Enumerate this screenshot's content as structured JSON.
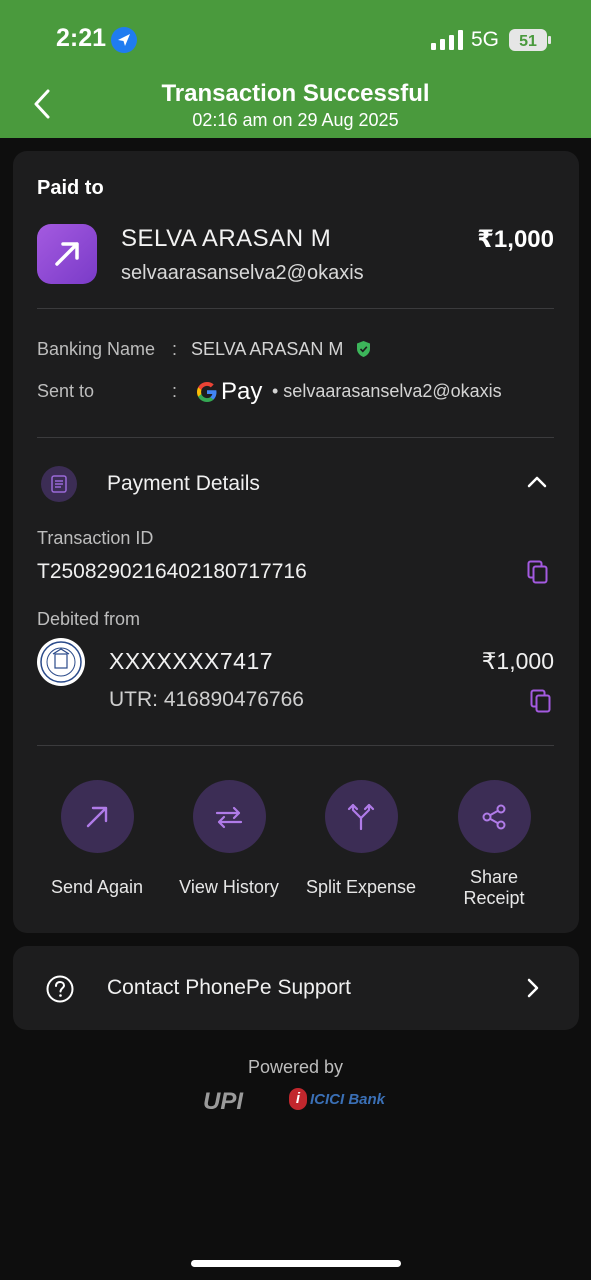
{
  "status_bar": {
    "time": "2:21",
    "network": "5G",
    "battery": "51"
  },
  "header": {
    "title": "Transaction Successful",
    "subtitle": "02:16 am on 29 Aug 2025"
  },
  "payee": {
    "section_label": "Paid to",
    "name": "SELVA ARASAN M",
    "vpa": "selvaarasanselva2@okaxis",
    "amount": "₹1,000"
  },
  "details": {
    "banking_name_label": "Banking Name",
    "banking_name": "SELVA ARASAN M",
    "sent_to_label": "Sent to",
    "colon": ":",
    "gpay_text": "Pay",
    "sent_to_vpa": "• selvaarasanselva2@okaxis"
  },
  "payment_details": {
    "title": "Payment Details",
    "transaction_id_label": "Transaction ID",
    "transaction_id": "T2508290216402180717716",
    "debited_from_label": "Debited from",
    "account": "XXXXXXX7417",
    "amount": "₹1,000",
    "utr": "UTR: 416890476766"
  },
  "actions": [
    "Send Again",
    "View History",
    "Split Expense",
    "Share Receipt"
  ],
  "support": {
    "label": "Contact PhonePe Support"
  },
  "footer": {
    "powered_by": "Powered by",
    "upi": "UPI",
    "icici": "ICICI Bank"
  },
  "colors": {
    "header_bg": "#4a9a3d",
    "accent_purple": "#a45ae0",
    "card_bg": "#1d1d1e"
  }
}
